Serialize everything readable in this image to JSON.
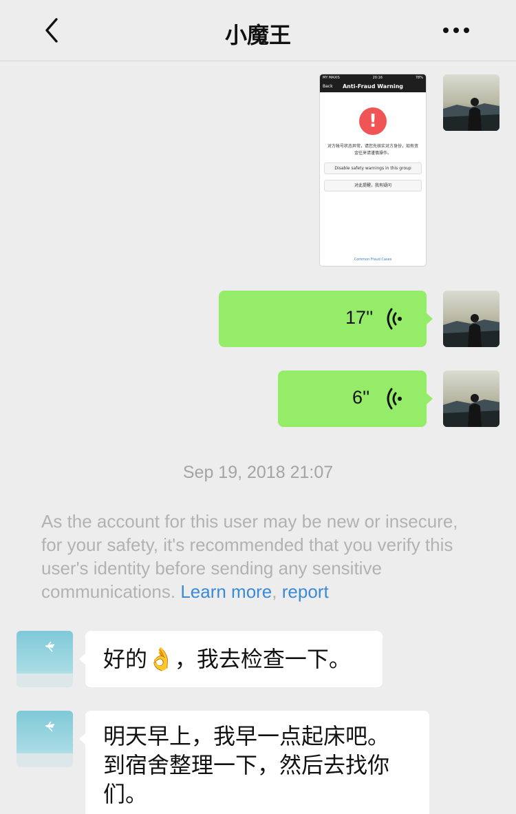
{
  "header": {
    "title": "小魔王",
    "back_icon": "chevron-left-icon",
    "more_icon": "ellipsis-icon"
  },
  "messages": {
    "image_msg": {
      "status_carrier": "MY MAXIS",
      "status_time": "20:16",
      "status_battery": "78%",
      "back_label": "Back",
      "title": "Anti-Fraud Warning",
      "text": "对方帐号状态异常，请您先核实对方身份，如有资金往来请谨慎操作。",
      "btn_disable": "Disable safety warnings in this group",
      "btn_report": "对此提醒，我有疑问",
      "link": "Common Fraud Cases"
    },
    "voice1": {
      "duration": "17''"
    },
    "voice2": {
      "duration": "6''"
    },
    "timestamp": "Sep 19, 2018 21:07",
    "system_notice": {
      "text": "As the account for this user may be new or insecure, for your safety, it's recommended that you verify this user's identity before sending any sensitive communications.",
      "learn_more": "Learn more",
      "separator": ",",
      "report": "report"
    },
    "incoming1": {
      "text": "好的👌，我去检查一下。"
    },
    "incoming2": {
      "line1": "明天早上，我早一点起床吧。",
      "line2": "到宿舍整理一下，然后去找你",
      "line3": "们。"
    }
  },
  "colors": {
    "outgoing_bubble": "#95ec69",
    "incoming_bubble": "#ffffff",
    "background": "#ededed",
    "link": "#3a8ad8"
  }
}
